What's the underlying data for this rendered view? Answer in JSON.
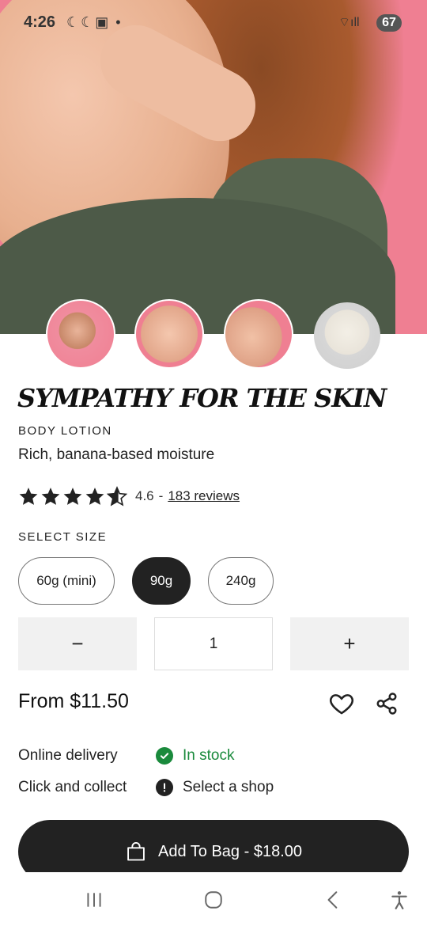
{
  "status_bar": {
    "time": "4:26",
    "left_icons": "☾☾▣ •",
    "wifi": "⌔ıll",
    "battery": "67"
  },
  "product": {
    "title": "SYMPATHY FOR THE SKIN",
    "category": "BODY LOTION",
    "tagline": "Rich, banana-based moisture",
    "rating": 4.6,
    "rating_text": "4.6",
    "rating_sep": "-",
    "reviews": "183 reviews"
  },
  "size": {
    "label": "SELECT SIZE",
    "options": [
      "60g (mini)",
      "90g",
      "240g"
    ],
    "selected": "90g"
  },
  "quantity": {
    "minus": "−",
    "value": "1",
    "plus": "+"
  },
  "price": "From $11.50",
  "availability": [
    {
      "label": "Online delivery",
      "status": "In stock",
      "icon": "check-circle",
      "color": "#1a8a3c"
    },
    {
      "label": "Click and collect",
      "status": "Select a shop",
      "icon": "exclamation-circle",
      "color": "#222222"
    }
  ],
  "add_to_bag": "Add To Bag - $18.00",
  "colors": {
    "accent": "#222222",
    "hero_bg": "#ef7f92",
    "in_stock": "#1a8a3c"
  },
  "nav_icons": [
    "recent-apps-icon",
    "home-icon",
    "back-icon",
    "accessibility-icon"
  ]
}
